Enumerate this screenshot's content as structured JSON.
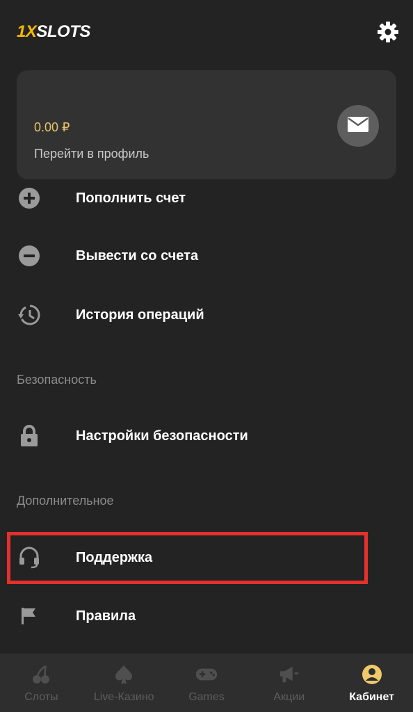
{
  "header": {
    "logo_part1": "1X",
    "logo_part2": "SLOTS",
    "settings_icon": "gear-icon"
  },
  "profile_card": {
    "balance": "0.00 ₽",
    "profile_link": "Перейти в профиль",
    "mail_icon": "envelope-icon"
  },
  "menu": {
    "deposit_label": "Пополнить счет",
    "withdraw_label": "Вывести со счета",
    "history_label": "История операций",
    "security_section": "Безопасность",
    "security_settings_label": "Настройки безопасности",
    "additional_section": "Дополнительное",
    "support_label": "Поддержка",
    "rules_label": "Правила"
  },
  "bottom_nav": {
    "items": [
      {
        "label": "Слоты",
        "icon": "cherries-icon",
        "active": false
      },
      {
        "label": "Live-Казино",
        "icon": "spade-icon",
        "active": false
      },
      {
        "label": "Games",
        "icon": "gamepad-icon",
        "active": false
      },
      {
        "label": "Акции",
        "icon": "megaphone-icon",
        "active": false
      },
      {
        "label": "Кабинет",
        "icon": "user-circle-icon",
        "active": true
      }
    ]
  },
  "colors": {
    "background": "#232323",
    "card": "#323232",
    "accent_gold": "#f5b800",
    "balance_gold": "#e9c46a",
    "highlight_red": "#e5302b",
    "inactive_gray": "#5d5d5d"
  }
}
